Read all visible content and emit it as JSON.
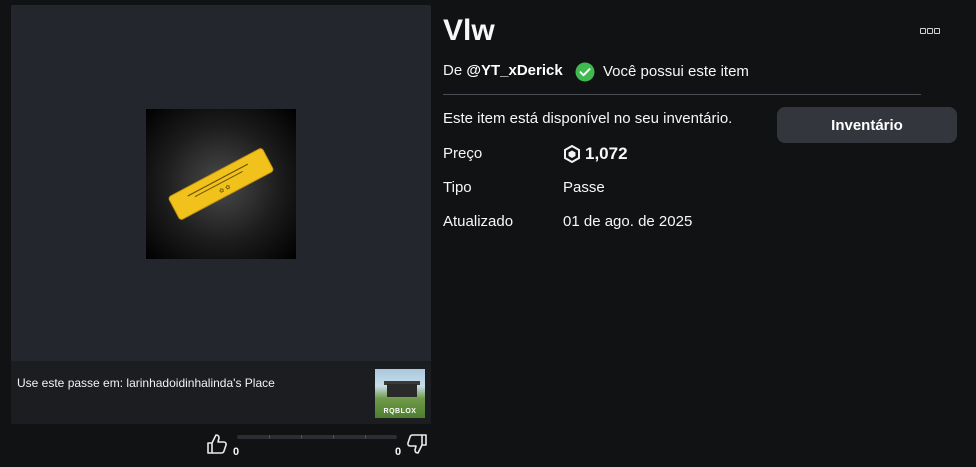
{
  "item": {
    "title": "Vlw",
    "by_prefix": "De",
    "creator": "@YT_xDerick",
    "owned_text": "Você possui este item",
    "available_text": "Este item está disponível no seu inventário.",
    "inventory_button": "Inventário"
  },
  "details": [
    {
      "label": "Preço",
      "value": "1,072"
    },
    {
      "label": "Tipo",
      "value": "Passe"
    },
    {
      "label": "Atualizado",
      "value": "01 de ago. de 2025"
    }
  ],
  "place": {
    "prefix": "Use este passe em:",
    "name": "larinhadoidinhalinda's Place",
    "thumbnail_brand": "RQBLOX"
  },
  "votes": {
    "up": "0",
    "down": "0"
  },
  "colors": {
    "background": "#111214",
    "panel": "#23262c",
    "owned_check": "#3fb950",
    "item_yellow": "#f1c21b"
  },
  "icons": [
    "more-options-icon",
    "owned-check-icon",
    "robux-icon",
    "thumbs-up-icon",
    "thumbs-down-icon"
  ]
}
